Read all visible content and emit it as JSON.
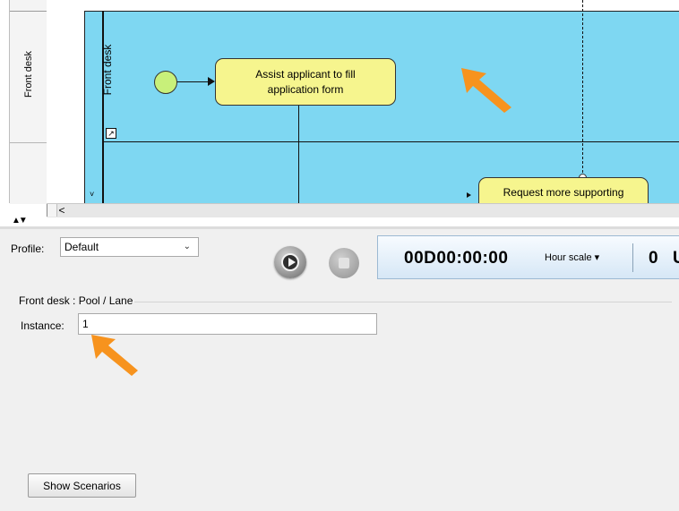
{
  "ruler": {
    "lane_label": "Front desk"
  },
  "diagram": {
    "lane_label": "Front desk",
    "task_1": "Assist applicant to fill application form",
    "task_2": "Request more supporting",
    "collapse_glyph": "˅",
    "resize_glyph": "↗"
  },
  "scrollbar": {
    "left_arrow": "<"
  },
  "splitter": {
    "arrows": "▲▼"
  },
  "panel": {
    "profile_label": "Profile:",
    "profile_value": "Default",
    "profile_chevron": "⌄",
    "clock": {
      "time": "00D00:00:00",
      "scale": "Hour scale ▾",
      "count": "0",
      "unit": "U"
    },
    "group_title": "Front desk : Pool / Lane",
    "instance_label": "Instance:",
    "instance_value": "1",
    "show_scenarios": "Show Scenarios"
  },
  "colors": {
    "pool_fill": "#7ed7f2",
    "task_fill": "#f6f58e",
    "start_event_fill": "#c8f07a",
    "callout_arrow": "#f7931e"
  },
  "icons": [
    "play-icon",
    "stop-icon",
    "start-event-icon",
    "callout-arrow-icon"
  ]
}
